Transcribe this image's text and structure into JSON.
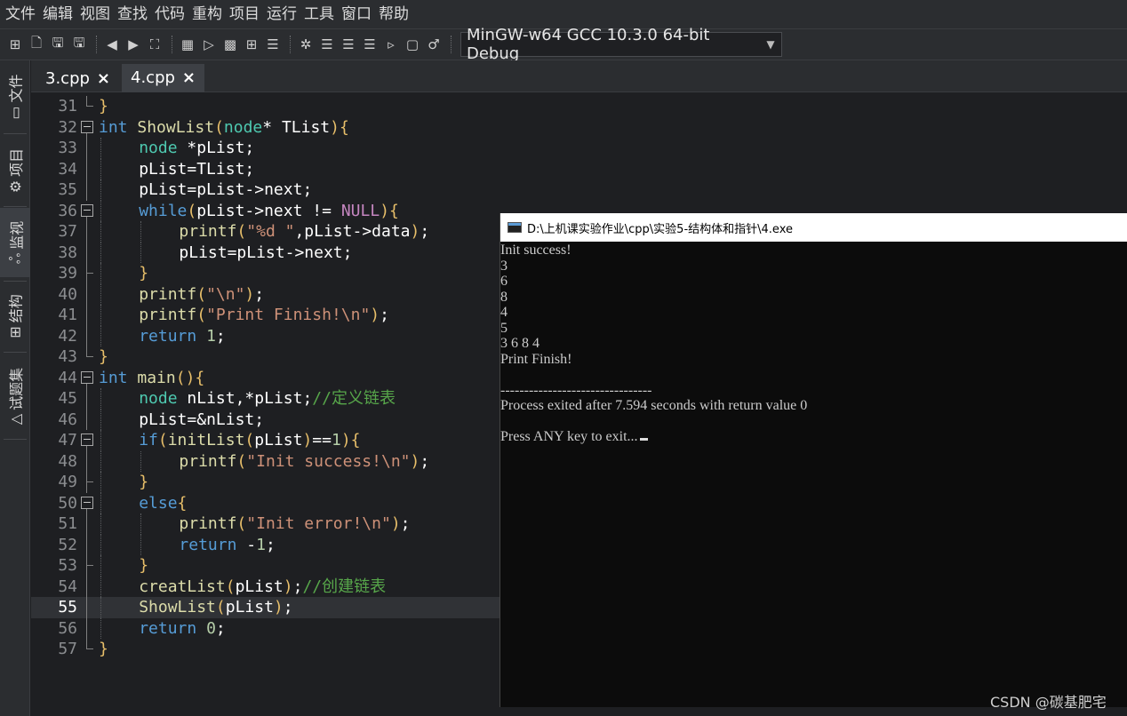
{
  "menu": [
    "文件",
    "编辑",
    "视图",
    "查找",
    "代码",
    "重构",
    "项目",
    "运行",
    "工具",
    "窗口",
    "帮助"
  ],
  "toolbar": {
    "compiler": "MinGW-w64 GCC 10.3.0 64-bit Debug"
  },
  "sidebar": {
    "tabs": [
      "文件",
      "项目",
      "监视",
      "结构",
      "试题集"
    ]
  },
  "tabs": [
    {
      "label": "3.cpp",
      "close": "×"
    },
    {
      "label": "4.cpp",
      "close": "×"
    }
  ],
  "editor": {
    "current_line": 55,
    "lines": [
      {
        "n": "31",
        "text": "}"
      },
      {
        "n": "32",
        "text": "int ShowList(node* TList){"
      },
      {
        "n": "33",
        "text": "node *pList;"
      },
      {
        "n": "34",
        "text": "pList=TList;"
      },
      {
        "n": "35",
        "text": "pList=pList->next;"
      },
      {
        "n": "36",
        "text": "while(pList->next != NULL){"
      },
      {
        "n": "37",
        "text": "printf(\"%d \",pList->data);"
      },
      {
        "n": "38",
        "text": "pList=pList->next;"
      },
      {
        "n": "39",
        "text": "}"
      },
      {
        "n": "40",
        "text": "printf(\"\\n\");"
      },
      {
        "n": "41",
        "text": "printf(\"Print Finish!\\n\");"
      },
      {
        "n": "42",
        "text": "return 1;"
      },
      {
        "n": "43",
        "text": "}"
      },
      {
        "n": "44",
        "text": "int main(){"
      },
      {
        "n": "45",
        "text": "node nList,*pList;//定义链表"
      },
      {
        "n": "46",
        "text": "pList=&nList;"
      },
      {
        "n": "47",
        "text": "if(initList(pList)==1){"
      },
      {
        "n": "48",
        "text": "printf(\"Init success!\\n\");"
      },
      {
        "n": "49",
        "text": "}"
      },
      {
        "n": "50",
        "text": "else{"
      },
      {
        "n": "51",
        "text": "printf(\"Init error!\\n\");"
      },
      {
        "n": "52",
        "text": "return -1;"
      },
      {
        "n": "53",
        "text": "}"
      },
      {
        "n": "54",
        "text": "creatList(pList);//创建链表"
      },
      {
        "n": "55",
        "text": "ShowList(pList);"
      },
      {
        "n": "56",
        "text": "return 0;"
      },
      {
        "n": "57",
        "text": "}"
      }
    ]
  },
  "console": {
    "title": "D:\\上机课实验作业\\cpp\\实验5-结构体和指针\\4.exe",
    "lines": [
      "Init success!",
      "3",
      "6",
      "8",
      "4",
      "5",
      "3 6 8 4",
      "Print Finish!",
      "",
      "--------------------------------",
      "Process exited after 7.594 seconds with return value 0",
      "",
      "Press ANY key to exit..."
    ]
  },
  "watermark": "CSDN @碳基肥宅"
}
